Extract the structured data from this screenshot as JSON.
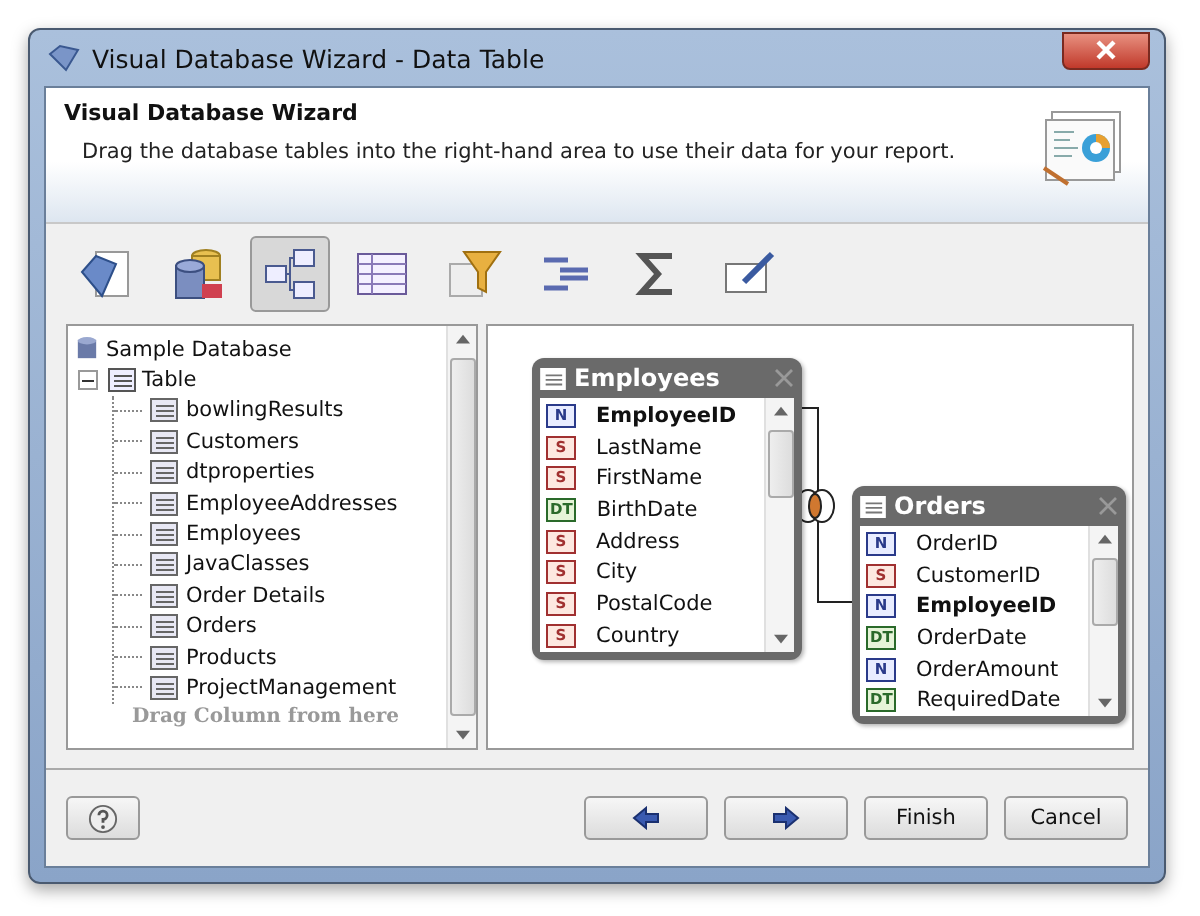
{
  "window": {
    "title": "Visual Database Wizard - Data Table"
  },
  "header": {
    "title": "Visual Database Wizard",
    "description": "Drag the database tables into the right-hand area to use their data for your report."
  },
  "toolbar": [
    {
      "kind": "gem",
      "selected": false
    },
    {
      "kind": "database",
      "selected": false
    },
    {
      "kind": "relations",
      "selected": true
    },
    {
      "kind": "grid",
      "selected": false
    },
    {
      "kind": "filter",
      "selected": false
    },
    {
      "kind": "sort",
      "selected": false
    },
    {
      "kind": "sum",
      "selected": false
    },
    {
      "kind": "edit",
      "selected": false
    }
  ],
  "tree": {
    "root": {
      "label": "Sample Database",
      "children": [
        {
          "label": "Table",
          "expanded": true,
          "children": [
            {
              "label": "bowlingResults"
            },
            {
              "label": "Customers"
            },
            {
              "label": "dtproperties"
            },
            {
              "label": "EmployeeAddresses"
            },
            {
              "label": "Employees"
            },
            {
              "label": "JavaClasses"
            },
            {
              "label": "Order Details"
            },
            {
              "label": "Orders"
            },
            {
              "label": "Products"
            },
            {
              "label": "ProjectManagement"
            }
          ]
        }
      ]
    },
    "hint": "Drag Column from here"
  },
  "diagram": {
    "tables": [
      {
        "title": "Employees",
        "fields": [
          {
            "type": "N",
            "kind": "number",
            "name": "EmployeeID",
            "key": true
          },
          {
            "type": "S",
            "kind": "string",
            "name": "LastName",
            "key": false
          },
          {
            "type": "S",
            "kind": "string",
            "name": "FirstName",
            "key": false
          },
          {
            "type": "DT",
            "kind": "date",
            "name": "BirthDate",
            "key": false
          },
          {
            "type": "S",
            "kind": "string",
            "name": "Address",
            "key": false
          },
          {
            "type": "S",
            "kind": "string",
            "name": "City",
            "key": false
          },
          {
            "type": "S",
            "kind": "string",
            "name": "PostalCode",
            "key": false
          },
          {
            "type": "S",
            "kind": "string",
            "name": "Country",
            "key": false
          }
        ]
      },
      {
        "title": "Orders",
        "fields": [
          {
            "type": "N",
            "kind": "number",
            "name": "OrderID",
            "key": false
          },
          {
            "type": "S",
            "kind": "string",
            "name": "CustomerID",
            "key": false
          },
          {
            "type": "N",
            "kind": "number",
            "name": "EmployeeID",
            "key": true
          },
          {
            "type": "DT",
            "kind": "date",
            "name": "OrderDate",
            "key": false
          },
          {
            "type": "N",
            "kind": "number",
            "name": "OrderAmount",
            "key": false
          },
          {
            "type": "DT",
            "kind": "date",
            "name": "RequiredDate",
            "key": false
          }
        ]
      }
    ]
  },
  "buttons": [
    {
      "kind": "help"
    },
    {
      "kind": "back"
    },
    {
      "kind": "next"
    },
    {
      "kind": "text",
      "label": "Finish"
    },
    {
      "kind": "text",
      "label": "Cancel"
    }
  ]
}
